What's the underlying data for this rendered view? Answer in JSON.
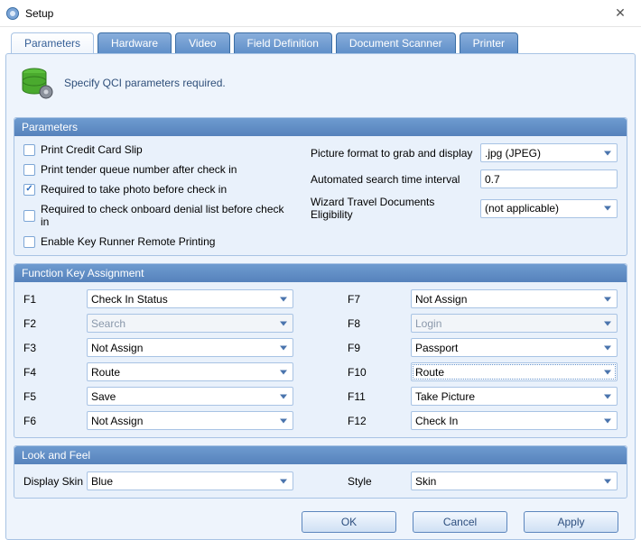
{
  "window": {
    "title": "Setup"
  },
  "tabs": [
    {
      "label": "Parameters",
      "active": true
    },
    {
      "label": "Hardware"
    },
    {
      "label": "Video"
    },
    {
      "label": "Field Definition"
    },
    {
      "label": "Document Scanner"
    },
    {
      "label": "Printer"
    }
  ],
  "description": "Specify QCI parameters required.",
  "sections": {
    "parameters": {
      "title": "Parameters",
      "checks": [
        {
          "label": "Print Credit Card Slip",
          "checked": false
        },
        {
          "label": "Print tender queue number after check in",
          "checked": false
        },
        {
          "label": "Required to take photo before check in",
          "checked": true
        },
        {
          "label": "Required to check onboard denial list before check in",
          "checked": false
        },
        {
          "label": "Enable Key Runner Remote Printing",
          "checked": false
        }
      ],
      "settings": [
        {
          "label": "Picture format to grab and display",
          "type": "select",
          "value": ".jpg (JPEG)"
        },
        {
          "label": "Automated search time interval",
          "type": "input",
          "value": "0.7"
        },
        {
          "label": "Wizard Travel Documents Eligibility",
          "type": "select",
          "value": "(not applicable)"
        }
      ]
    },
    "fkeys": {
      "title": "Function Key Assignment",
      "left": [
        {
          "key": "F1",
          "value": "Check In Status",
          "disabled": false
        },
        {
          "key": "F2",
          "value": "Search",
          "disabled": true
        },
        {
          "key": "F3",
          "value": "Not Assign",
          "disabled": false
        },
        {
          "key": "F4",
          "value": "Route",
          "disabled": false
        },
        {
          "key": "F5",
          "value": "Save",
          "disabled": false
        },
        {
          "key": "F6",
          "value": "Not Assign",
          "disabled": false
        }
      ],
      "right": [
        {
          "key": "F7",
          "value": "Not Assign",
          "disabled": false
        },
        {
          "key": "F8",
          "value": "Login",
          "disabled": true
        },
        {
          "key": "F9",
          "value": "Passport",
          "disabled": false
        },
        {
          "key": "F10",
          "value": "Route",
          "disabled": false,
          "highlight": true
        },
        {
          "key": "F11",
          "value": "Take Picture",
          "disabled": false
        },
        {
          "key": "F12",
          "value": "Check In",
          "disabled": false
        }
      ]
    },
    "lookfeel": {
      "title": "Look and Feel",
      "skin_label": "Display Skin",
      "skin_value": "Blue",
      "style_label": "Style",
      "style_value": "Skin"
    }
  },
  "buttons": {
    "ok": "OK",
    "cancel": "Cancel",
    "apply": "Apply"
  }
}
